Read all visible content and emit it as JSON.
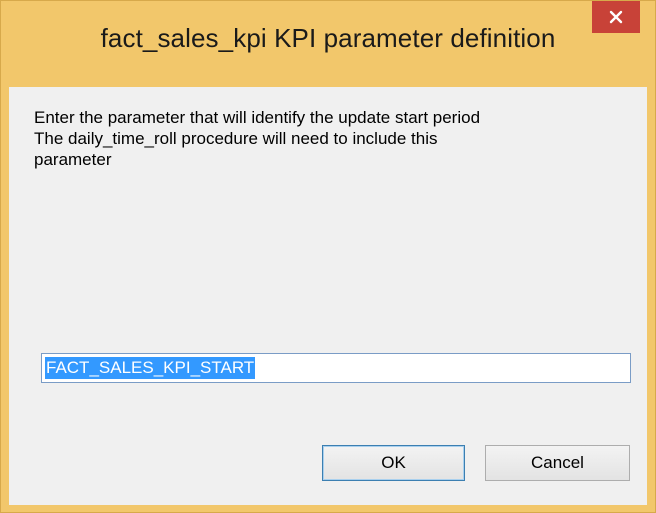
{
  "window": {
    "title": "fact_sales_kpi KPI parameter definition",
    "close_icon": "close-icon"
  },
  "dialog": {
    "prompt_lines": [
      "Enter the parameter that will identify the update start period",
      "The daily_time_roll procedure will need to include this",
      "parameter"
    ],
    "parameter_value": "FACT_SALES_KPI_START"
  },
  "buttons": {
    "ok_label": "OK",
    "cancel_label": "Cancel"
  },
  "colors": {
    "title_bar": "#f2c76b",
    "close_button": "#c84238",
    "client_background": "#f0f0f0",
    "selection_highlight": "#3399ff"
  }
}
